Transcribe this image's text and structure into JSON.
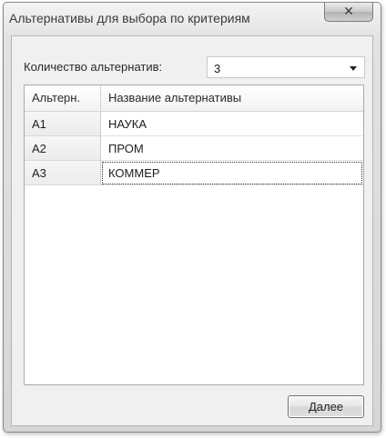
{
  "window": {
    "title": "Альтернативы для выбора по критериям",
    "close_icon": "close-icon"
  },
  "count": {
    "label": "Количество альтернатив:",
    "value": "3"
  },
  "grid": {
    "columns": [
      "Альтерн.",
      "Название альтернативы"
    ],
    "rows": [
      {
        "code": "A1",
        "name": "НАУКА"
      },
      {
        "code": "A2",
        "name": "ПРОМ"
      },
      {
        "code": "A3",
        "name": "КОММЕР"
      }
    ]
  },
  "buttons": {
    "next_label": "Далее"
  }
}
